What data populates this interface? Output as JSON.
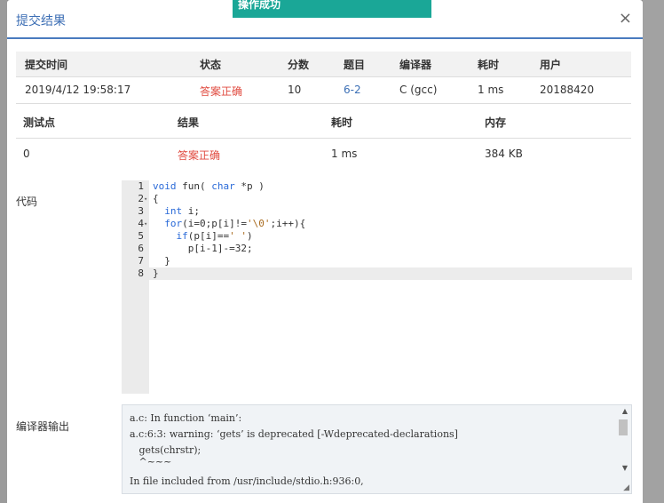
{
  "toast": "操作成功",
  "modal": {
    "title": "提交结果",
    "close": "×"
  },
  "summary": {
    "headers": [
      "提交时间",
      "状态",
      "分数",
      "题目",
      "编译器",
      "耗时",
      "用户"
    ],
    "row": [
      "2019/4/12 19:58:17",
      "答案正确",
      "10",
      "6-2",
      "C (gcc)",
      "1 ms",
      "20188420"
    ]
  },
  "tests": {
    "headers": [
      "测试点",
      "结果",
      "耗时",
      "内存"
    ],
    "row": [
      "0",
      "答案正确",
      "1 ms",
      "384 KB"
    ]
  },
  "labels": {
    "code": "代码",
    "compiler_output": "编译器输出"
  },
  "code_lines": [
    "void fun( char *p )",
    "{",
    "  int i;",
    "  for(i=0;p[i]!='\\0';i++){",
    "    if(p[i]==' ')",
    "      p[i-1]-=32;",
    "  }",
    "}"
  ],
  "compiler_output": [
    "a.c: In function ‘main’:",
    "a.c:6:3: warning: ‘gets’ is deprecated [-Wdeprecated-declarations]",
    "   gets(chrstr);",
    "   ^~~~",
    "In file included from /usr/include/stdio.h:936:0,"
  ]
}
